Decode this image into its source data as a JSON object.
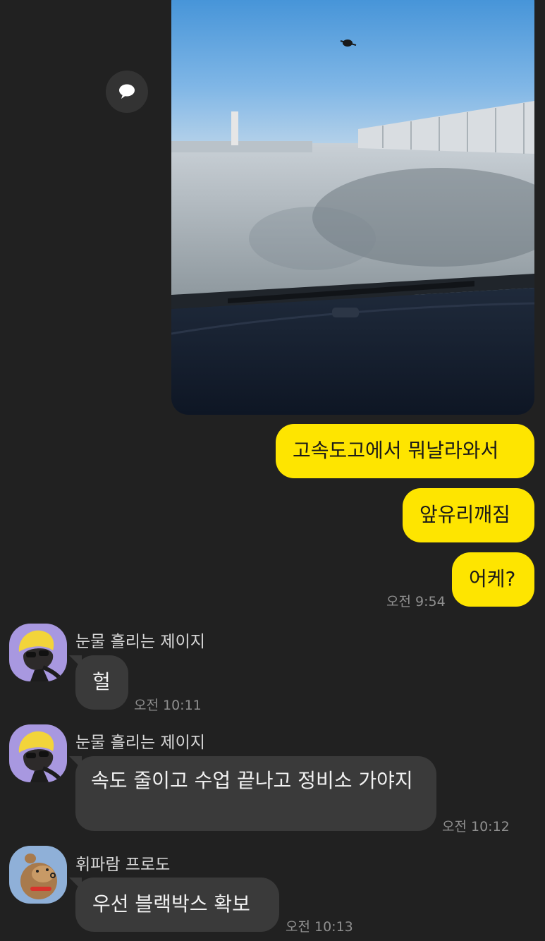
{
  "messages": {
    "sent": [
      {
        "text": "고속도고에서 뭐날라와서"
      },
      {
        "text": "앞유리깨짐"
      },
      {
        "text": "어케?"
      }
    ],
    "sent_time": "오전 9:54",
    "received": [
      {
        "sender": "눈물 흘리는 제이지",
        "text": "헐",
        "time": "오전 10:11"
      },
      {
        "sender": "눈물 흘리는 제이지",
        "text": "속도 줄이고 수업 끝나고 정비소 가야지",
        "time": "오전 10:12"
      },
      {
        "sender": "휘파람 프로도",
        "text": "우선 블랙박스 확보",
        "time": "오전 10:13"
      }
    ]
  },
  "icons": {
    "share": "speech-bubble-icon",
    "avatar_jay": "jay-g-crying-avatar",
    "avatar_frodo": "frodo-whistling-avatar"
  },
  "colors": {
    "background": "#212121",
    "my_bubble": "#fee500",
    "other_bubble": "#3a3a3a",
    "timestamp": "#8f8f8f"
  }
}
